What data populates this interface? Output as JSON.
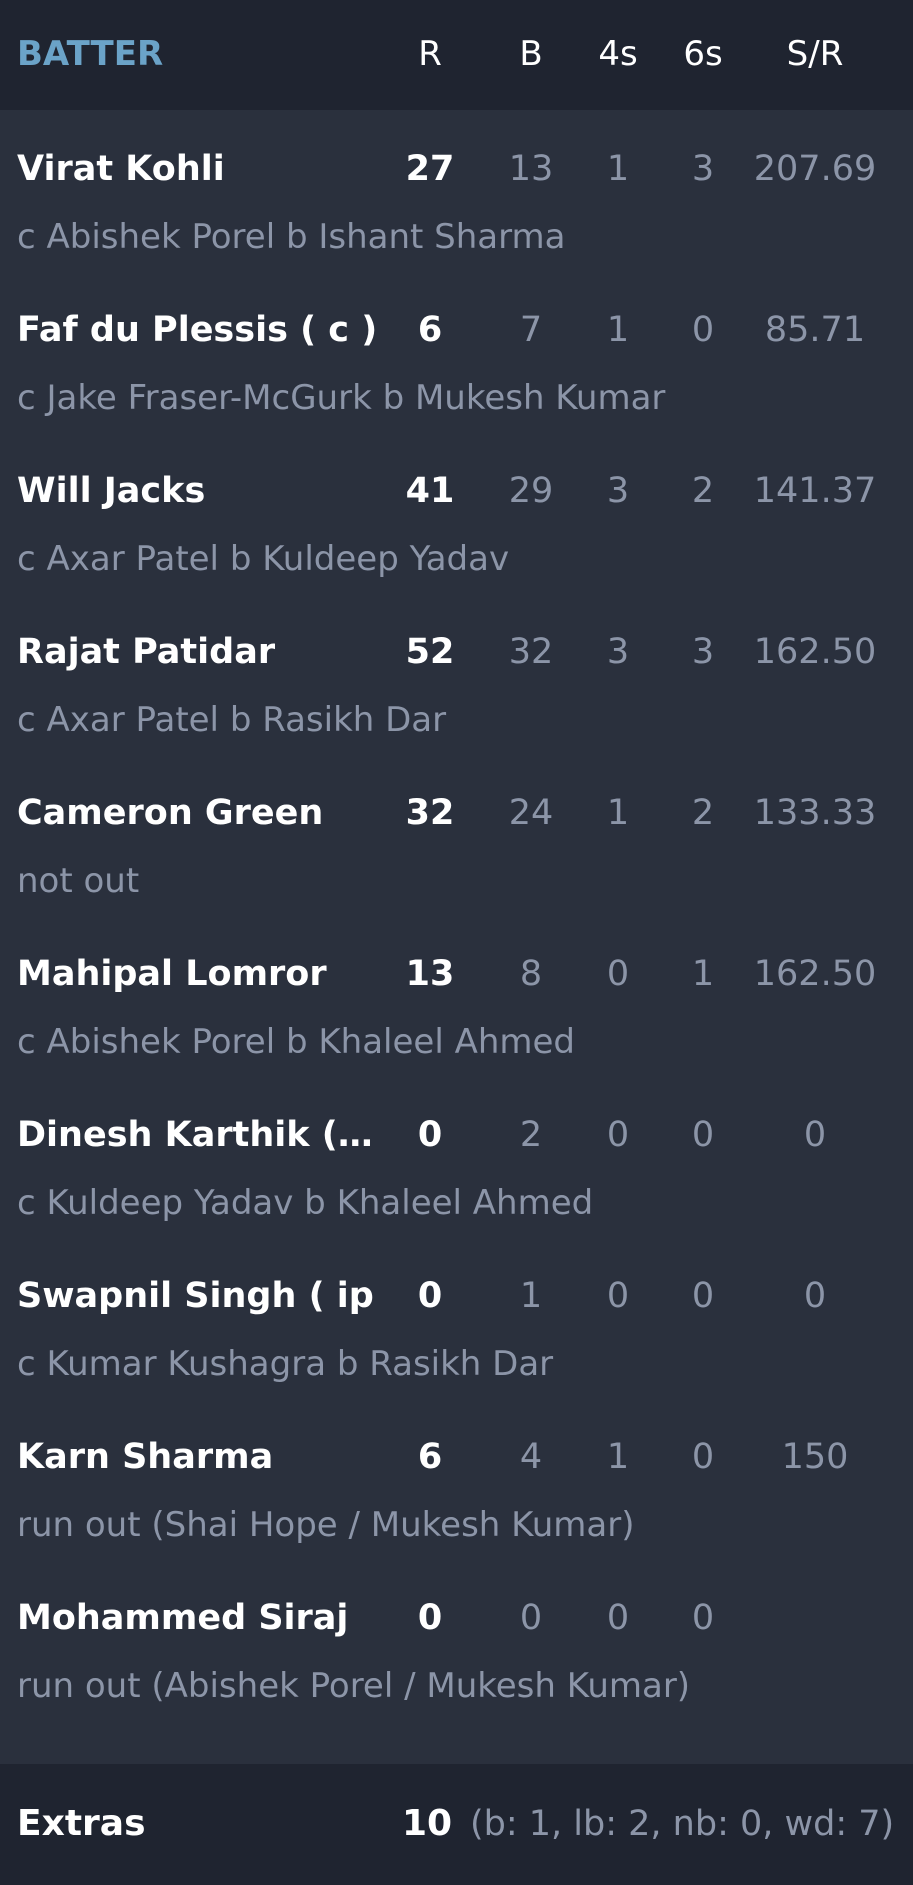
{
  "header": {
    "batter": "BATTER",
    "r": "R",
    "b": "B",
    "fours": "4s",
    "sixes": "6s",
    "sr": "S/R"
  },
  "batters": [
    {
      "name": "Virat Kohli",
      "runs": "27",
      "balls": "13",
      "fours": "1",
      "sixes": "3",
      "sr": "207.69",
      "dismissal": "c Abishek Porel b Ishant Sharma"
    },
    {
      "name": "Faf du Plessis ( c )",
      "runs": "6",
      "balls": "7",
      "fours": "1",
      "sixes": "0",
      "sr": "85.71",
      "dismissal": "c Jake Fraser-McGurk b Mukesh Kumar"
    },
    {
      "name": "Will Jacks",
      "runs": "41",
      "balls": "29",
      "fours": "3",
      "sixes": "2",
      "sr": "141.37",
      "dismissal": "c Axar Patel b Kuldeep Yadav"
    },
    {
      "name": "Rajat Patidar",
      "runs": "52",
      "balls": "32",
      "fours": "3",
      "sixes": "3",
      "sr": "162.50",
      "dismissal": "c Axar Patel b Rasikh Dar"
    },
    {
      "name": "Cameron Green",
      "runs": "32",
      "balls": "24",
      "fours": "1",
      "sixes": "2",
      "sr": "133.33",
      "dismissal": "not out"
    },
    {
      "name": "Mahipal Lomror",
      "runs": "13",
      "balls": "8",
      "fours": "0",
      "sixes": "1",
      "sr": "162.50",
      "dismissal": "c Abishek Porel b Khaleel Ahmed"
    },
    {
      "name": "Dinesh Karthik (…",
      "runs": "0",
      "balls": "2",
      "fours": "0",
      "sixes": "0",
      "sr": "0",
      "dismissal": "c Kuldeep Yadav b Khaleel Ahmed"
    },
    {
      "name": "Swapnil Singh ( ip )",
      "runs": "0",
      "balls": "1",
      "fours": "0",
      "sixes": "0",
      "sr": "0",
      "dismissal": "c Kumar Kushagra b Rasikh Dar"
    },
    {
      "name": "Karn Sharma",
      "runs": "6",
      "balls": "4",
      "fours": "1",
      "sixes": "0",
      "sr": "150",
      "dismissal": "run out (Shai Hope / Mukesh Kumar)"
    },
    {
      "name": "Mohammed Siraj",
      "runs": "0",
      "balls": "0",
      "fours": "0",
      "sixes": "0",
      "sr": "",
      "dismissal": "run out (Abishek Porel / Mukesh Kumar)"
    }
  ],
  "extras": {
    "label": "Extras",
    "total": "10",
    "detail": "(b: 1, lb: 2, nb: 0, wd: 7)"
  }
}
